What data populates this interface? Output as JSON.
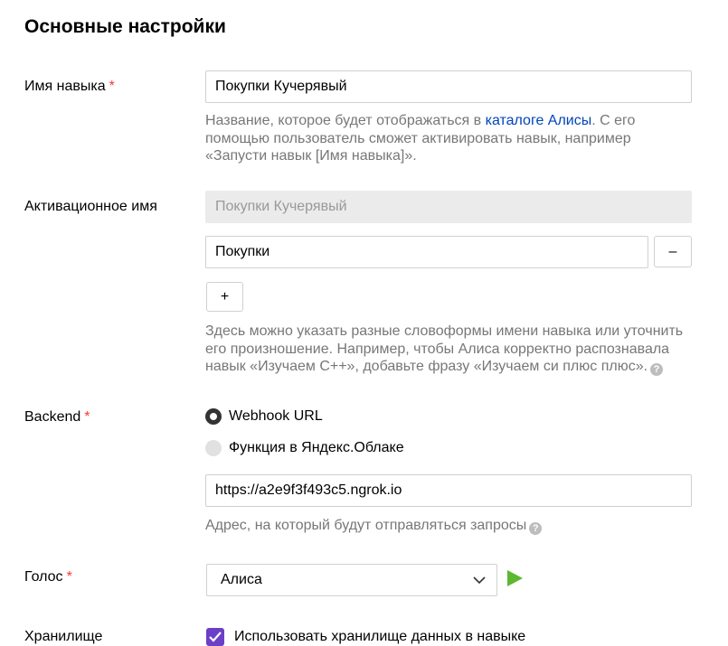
{
  "section_title": "Основные настройки",
  "required_mark": "*",
  "skill_name": {
    "label": "Имя навыка",
    "value": "Покупки Кучерявый",
    "hint_before": "Название, которое будет отображаться в ",
    "hint_link": "каталоге Алисы",
    "hint_after_line1": ". С его",
    "hint_line2": "помощью пользователь сможет активировать навык, например",
    "hint_line3": "«Запусти навык [Имя навыка]»."
  },
  "activation": {
    "label": "Активационное имя",
    "disabled_value": "Покупки Кучерявый",
    "alt_value": "Покупки",
    "remove_label": "–",
    "add_label": "+",
    "hint_line1": "Здесь можно указать разные словоформы имени навыка или уточнить",
    "hint_line2": "его произношение. Например, чтобы Алиса корректно распознавала",
    "hint_line3": "навык «Изучаем С++», добавьте фразу «Изучаем си плюс плюс».",
    "help_glyph": "?"
  },
  "backend": {
    "label": "Backend",
    "options": [
      "Webhook URL",
      "Функция в Яндекс.Облаке"
    ],
    "selected": "Webhook URL",
    "url_value": "https://a2e9f3f493c5.ngrok.io",
    "hint": "Адрес, на который будут отправляться запросы",
    "help_glyph": "?"
  },
  "voice": {
    "label": "Голос",
    "selected": "Алиса"
  },
  "storage": {
    "label": "Хранилище",
    "checkbox_label": "Использовать хранилище данных в навыке",
    "checked": true
  },
  "colors": {
    "required": "#ff3333",
    "link": "#0044bb",
    "play": "#5cb82e",
    "checkbox": "#6b3fc8"
  }
}
